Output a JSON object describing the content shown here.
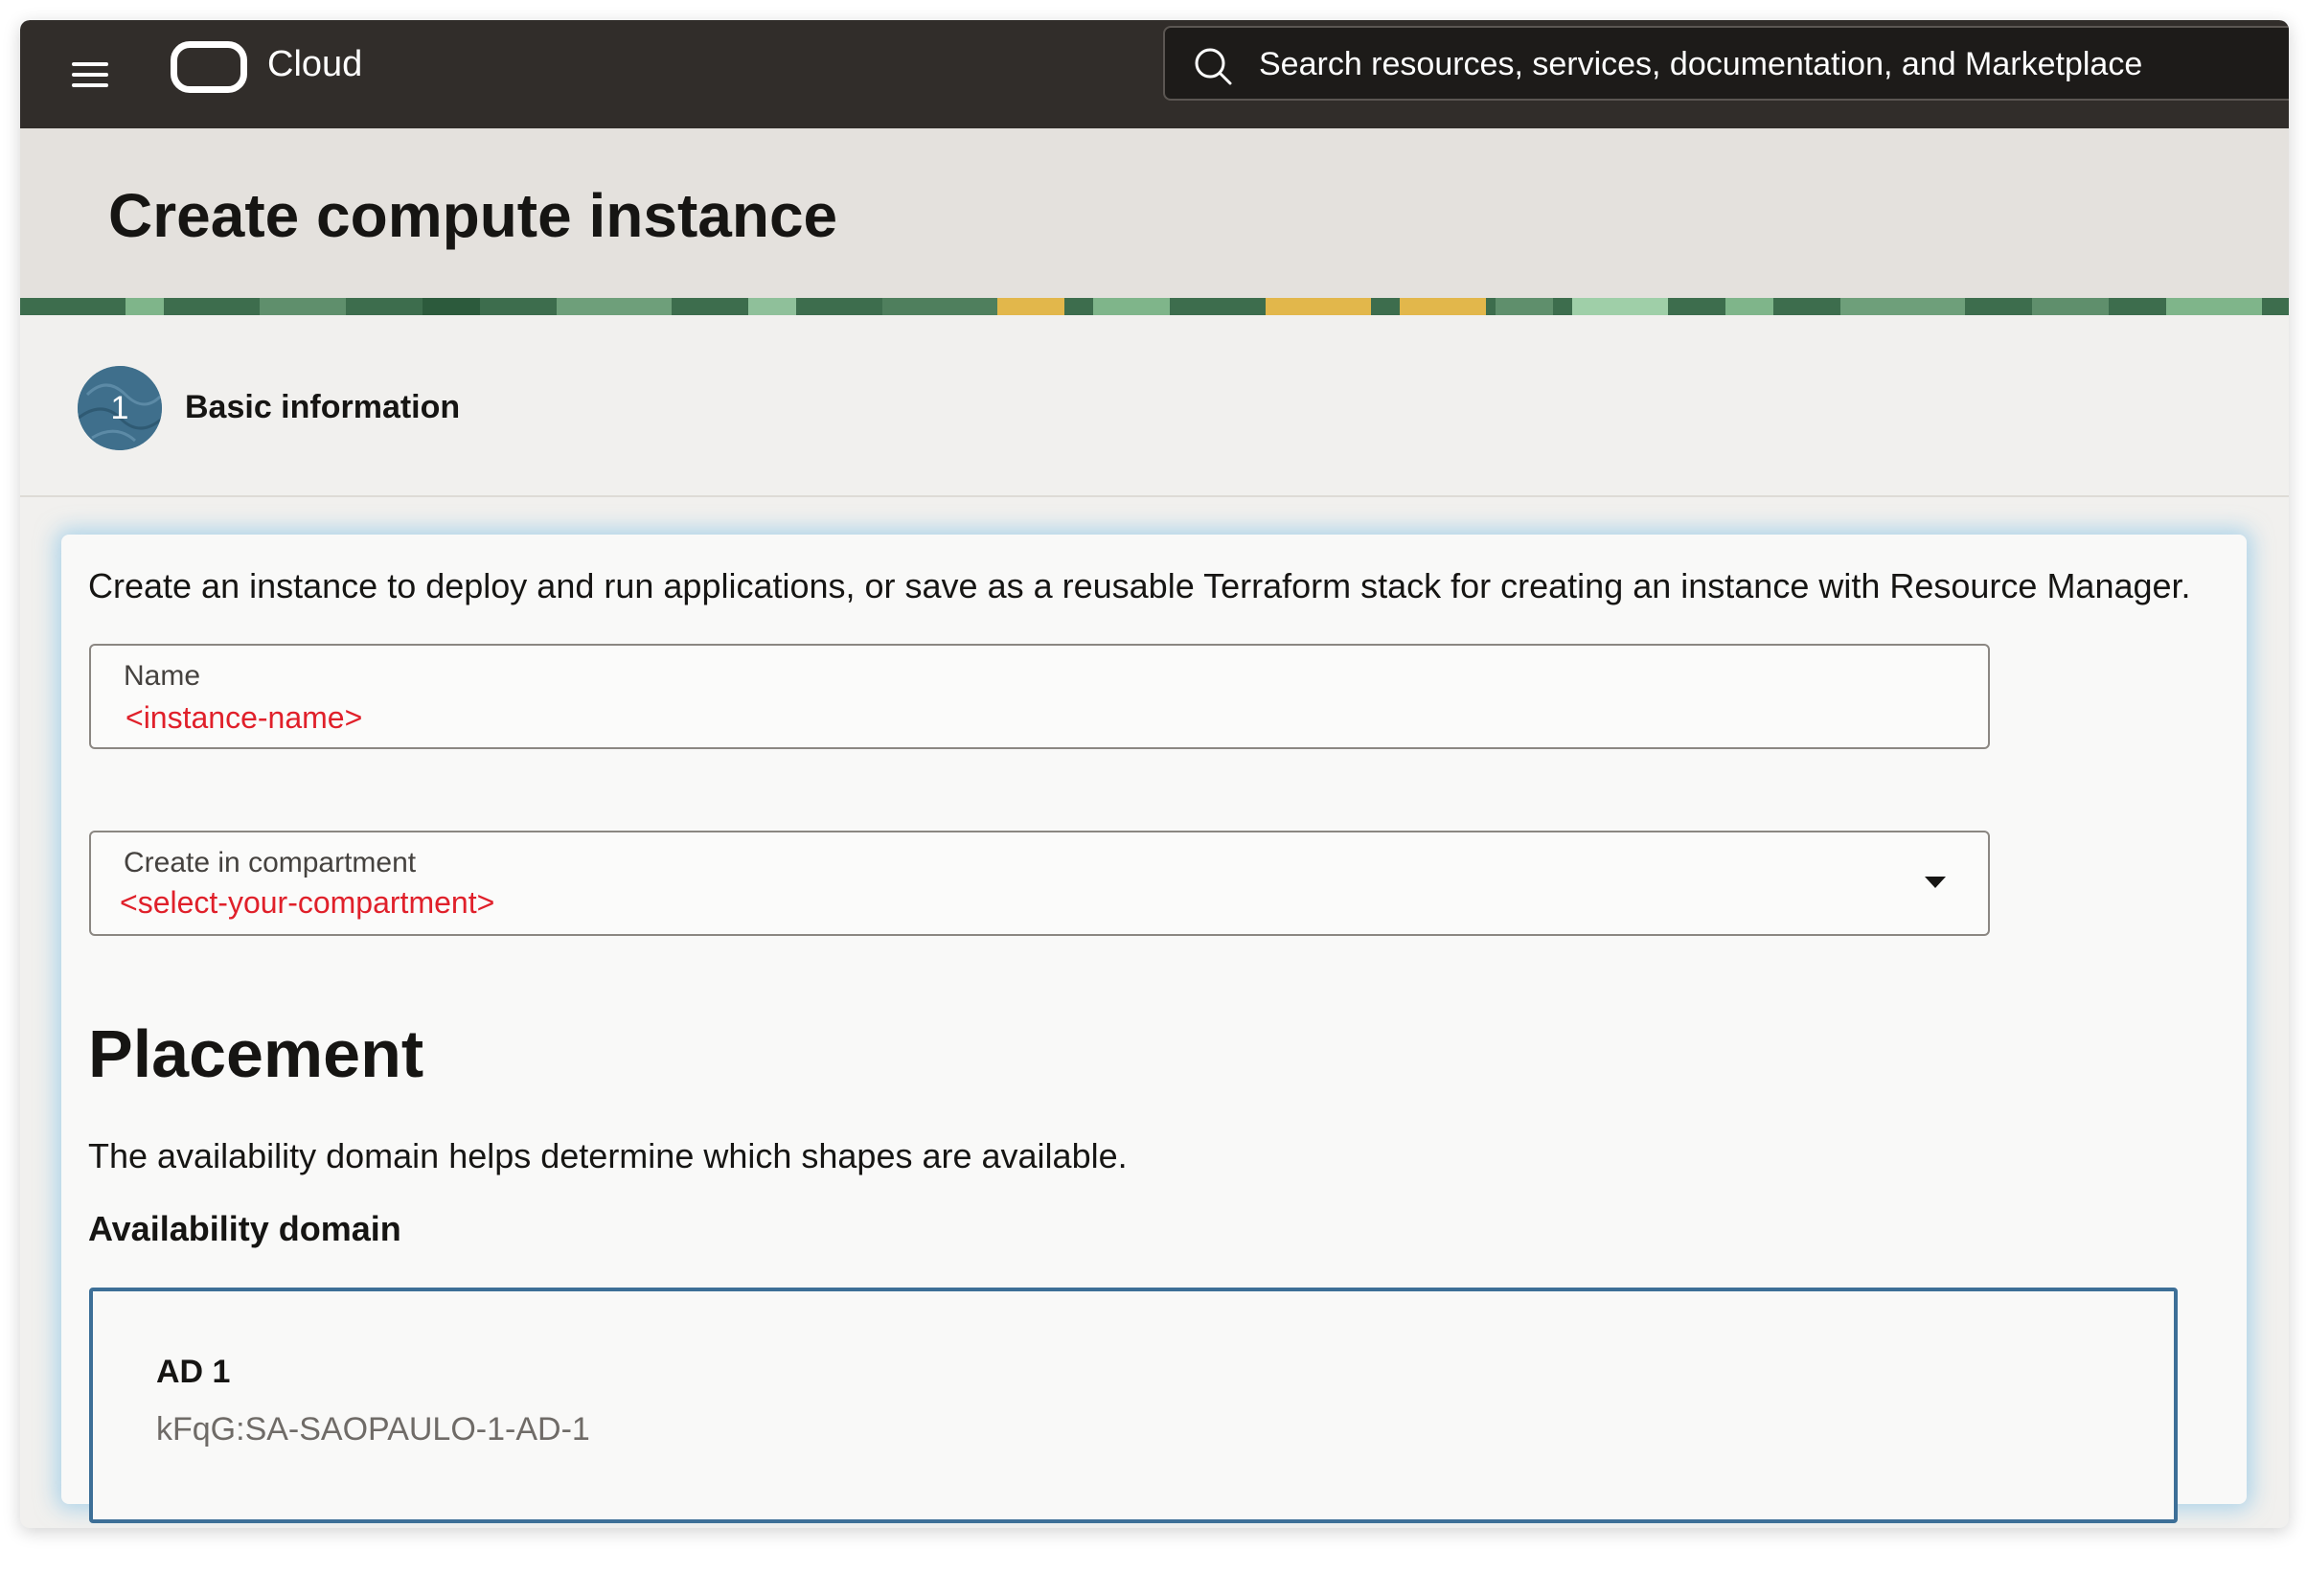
{
  "header": {
    "brand": "Cloud",
    "search": {
      "placeholder": "Search resources, services, documentation, and Marketplace"
    }
  },
  "page": {
    "title": "Create compute instance"
  },
  "step": {
    "number": "1",
    "label": "Basic information"
  },
  "form": {
    "intro": "Create an instance to deploy and run applications, or save as a reusable Terraform stack for creating an instance with Resource Manager.",
    "name_field": {
      "label": "Name",
      "value": "<instance-name>"
    },
    "compartment_field": {
      "label": "Create in compartment",
      "value": "<select-your-compartment>"
    }
  },
  "placement": {
    "heading": "Placement",
    "description": "The availability domain helps determine which shapes are available.",
    "availability_label": "Availability domain",
    "domain": {
      "name": "AD 1",
      "id": "kFqG:SA-SAOPAULO-1-AD-1"
    }
  },
  "colors": {
    "topbar": "#312d2a",
    "titlebar": "#e4e1dd",
    "placeholder_red": "#e0202a",
    "selected_border": "#3d6f97",
    "step_badge": "#3f6f8c"
  }
}
